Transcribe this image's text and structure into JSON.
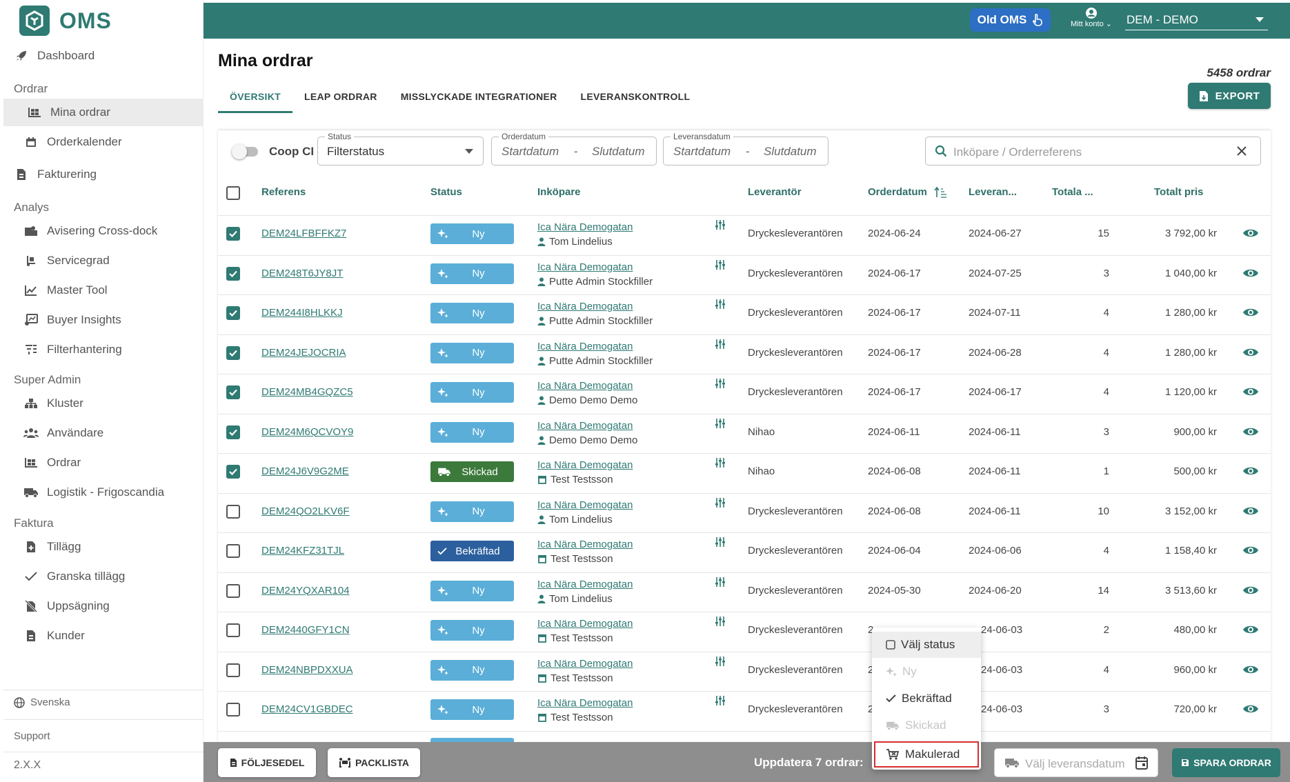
{
  "app": {
    "logo_text": "OMS"
  },
  "sidebar": {
    "dashboard": "Dashboard",
    "section_orders": "Ordrar",
    "my_orders": "Mina ordrar",
    "order_calendar": "Orderkalender",
    "invoicing": "Fakturering",
    "section_analysis": "Analys",
    "crossdock": "Avisering Cross-dock",
    "service_level": "Servicegrad",
    "master_tool": "Master Tool",
    "buyer_insights": "Buyer Insights",
    "filter_mgmt": "Filterhantering",
    "section_superadmin": "Super Admin",
    "clusters": "Kluster",
    "users": "Användare",
    "orders": "Ordrar",
    "logistics": "Logistik - Frigoscandia",
    "section_invoice": "Faktura",
    "addons": "Tillägg",
    "review_addons": "Granska tillägg",
    "termination": "Uppsägning",
    "customers": "Kunder",
    "language": "Svenska",
    "support": "Support",
    "version": "2.X.X"
  },
  "topbar": {
    "old_oms": "Old OMS",
    "account": "Mitt konto",
    "org": "DEM - DEMO"
  },
  "page": {
    "title": "Mina ordrar",
    "order_count": "5458 ordrar",
    "export": "EXPORT"
  },
  "tabs": [
    "ÖVERSIKT",
    "LEAP ORDRAR",
    "MISSLYCKADE INTEGRATIONER",
    "LEVERANSKONTROLL"
  ],
  "filters": {
    "toggle_label": "Coop CI",
    "status_legend": "Status",
    "status_value": "Filterstatus",
    "orderdate_legend": "Orderdatum",
    "deliverydate_legend": "Leveransdatum",
    "start": "Startdatum",
    "end": "Slutdatum",
    "dash": "-",
    "search_placeholder": "Inköpare / Orderreferens"
  },
  "table": {
    "columns": [
      "Referens",
      "Status",
      "Inköpare",
      "Leverantör",
      "Orderdatum",
      "Leveran...",
      "Totala ...",
      "Totalt pris"
    ],
    "rows": [
      {
        "checked": true,
        "ref": "DEM24LFBFFKZ7",
        "status": "Ny",
        "store": "Ica Nära Demogatan",
        "user": "Tom Lindelius",
        "user_type": "person",
        "supplier": "Dryckesleverantören",
        "order_date": "2024-06-24",
        "delivery_date": "2024-06-27",
        "total": "15",
        "price": "3 792,00 kr"
      },
      {
        "checked": true,
        "ref": "DEM248T6JY8JT",
        "status": "Ny",
        "store": "Ica Nära Demogatan",
        "user": "Putte Admin Stockfiller",
        "user_type": "person",
        "supplier": "Dryckesleverantören",
        "order_date": "2024-06-17",
        "delivery_date": "2024-07-25",
        "total": "3",
        "price": "1 040,00 kr"
      },
      {
        "checked": true,
        "ref": "DEM244I8HLKKJ",
        "status": "Ny",
        "store": "Ica Nära Demogatan",
        "user": "Putte Admin Stockfiller",
        "user_type": "person",
        "supplier": "Dryckesleverantören",
        "order_date": "2024-06-17",
        "delivery_date": "2024-07-11",
        "total": "4",
        "price": "1 280,00 kr"
      },
      {
        "checked": true,
        "ref": "DEM24JEJOCRIA",
        "status": "Ny",
        "store": "Ica Nära Demogatan",
        "user": "Putte Admin Stockfiller",
        "user_type": "person",
        "supplier": "Dryckesleverantören",
        "order_date": "2024-06-17",
        "delivery_date": "2024-06-28",
        "total": "4",
        "price": "1 280,00 kr"
      },
      {
        "checked": true,
        "ref": "DEM24MB4GQZC5",
        "status": "Ny",
        "store": "Ica Nära Demogatan",
        "user": "Demo Demo Demo",
        "user_type": "person",
        "supplier": "Dryckesleverantören",
        "order_date": "2024-06-17",
        "delivery_date": "2024-06-17",
        "total": "4",
        "price": "1 120,00 kr"
      },
      {
        "checked": true,
        "ref": "DEM24M6QCVOY9",
        "status": "Ny",
        "store": "Ica Nära Demogatan",
        "user": "Demo Demo Demo",
        "user_type": "person",
        "supplier": "Nihao",
        "order_date": "2024-06-11",
        "delivery_date": "2024-06-11",
        "total": "3",
        "price": "900,00 kr"
      },
      {
        "checked": true,
        "ref": "DEM24J6V9G2ME",
        "status": "Skickad",
        "store": "Ica Nära Demogatan",
        "user": "Test Testsson",
        "user_type": "store",
        "supplier": "Nihao",
        "order_date": "2024-06-08",
        "delivery_date": "2024-06-11",
        "total": "1",
        "price": "500,00 kr"
      },
      {
        "checked": false,
        "ref": "DEM24QO2LKV6F",
        "status": "Ny",
        "store": "Ica Nära Demogatan",
        "user": "Tom Lindelius",
        "user_type": "person",
        "supplier": "Dryckesleverantören",
        "order_date": "2024-06-08",
        "delivery_date": "2024-06-11",
        "total": "10",
        "price": "3 152,00 kr"
      },
      {
        "checked": false,
        "ref": "DEM24KFZ31TJL",
        "status": "Bekräftad",
        "store": "Ica Nära Demogatan",
        "user": "Test Testsson",
        "user_type": "store",
        "supplier": "Dryckesleverantören",
        "order_date": "2024-06-04",
        "delivery_date": "2024-06-06",
        "total": "4",
        "price": "1 158,40 kr"
      },
      {
        "checked": false,
        "ref": "DEM24YQXAR104",
        "status": "Ny",
        "store": "Ica Nära Demogatan",
        "user": "Tom Lindelius",
        "user_type": "person",
        "supplier": "Dryckesleverantören",
        "order_date": "2024-05-30",
        "delivery_date": "2024-06-20",
        "total": "14",
        "price": "3 513,60 kr"
      },
      {
        "checked": false,
        "ref": "DEM2440GFY1CN",
        "status": "Ny",
        "store": "Ica Nära Demogatan",
        "user": "Test Testsson",
        "user_type": "store",
        "supplier": "Dryckesleverantören",
        "order_date": "2",
        "delivery_date": "24-06-03",
        "total": "2",
        "price": "480,00 kr"
      },
      {
        "checked": false,
        "ref": "DEM24NBPDXXUA",
        "status": "Ny",
        "store": "Ica Nära Demogatan",
        "user": "Test Testsson",
        "user_type": "store",
        "supplier": "Dryckesleverantören",
        "order_date": "2",
        "delivery_date": "24-06-03",
        "total": "4",
        "price": "960,00 kr"
      },
      {
        "checked": false,
        "ref": "DEM24CV1GBDEC",
        "status": "Ny",
        "store": "Ica Nära Demogatan",
        "user": "Test Testsson",
        "user_type": "store",
        "supplier": "Dryckesleverantören",
        "order_date": "2",
        "delivery_date": "24-06-03",
        "total": "3",
        "price": "720,00 kr"
      }
    ]
  },
  "status_colors": {
    "Ny": "#5aaed8",
    "Skickad": "#3b7a3b",
    "Bekräftad": "#2c5f9e"
  },
  "bottom": {
    "delivery_note": "FÖLJESEDEL",
    "packing_list": "PACKLISTA",
    "update_label": "Uppdatera 7 ordrar:",
    "delivery_date_placeholder": "Välj leveransdatum",
    "save": "SPARA ORDRAR"
  },
  "status_menu": {
    "choose": "Välj status",
    "new": "Ny",
    "confirmed": "Bekräftad",
    "sent": "Skickad",
    "voided": "Makulerad"
  }
}
